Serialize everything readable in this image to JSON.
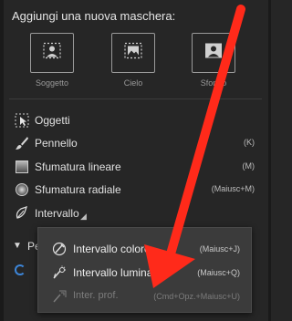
{
  "panel": {
    "heading": "Aggiungi una nuova maschera:",
    "mask_buttons": [
      {
        "label": "Soggetto",
        "icon": "subject-icon"
      },
      {
        "label": "Cielo",
        "icon": "sky-icon"
      },
      {
        "label": "Sfondo",
        "icon": "background-icon"
      }
    ]
  },
  "tools": [
    {
      "label": "Oggetti",
      "shortcut": "",
      "icon": "objects-icon"
    },
    {
      "label": "Pennello",
      "shortcut": "(K)",
      "icon": "brush-icon"
    },
    {
      "label": "Sfumatura lineare",
      "shortcut": "(M)",
      "icon": "linear-gradient-icon"
    },
    {
      "label": "Sfumatura radiale",
      "shortcut": "(Maiusc+M)",
      "icon": "radial-gradient-icon"
    },
    {
      "label": "Intervallo",
      "shortcut": "",
      "icon": "range-icon"
    }
  ],
  "section": {
    "label": "Pe",
    "collapsed_indicator": "▼"
  },
  "flyout": {
    "items": [
      {
        "label": "Intervallo colore",
        "shortcut": "(Maiusc+J)",
        "enabled": true,
        "icon": "color-range-icon"
      },
      {
        "label": "Intervallo luminanza",
        "shortcut": "(Maiusc+Q)",
        "enabled": true,
        "icon": "luminance-range-icon"
      },
      {
        "label": "Inter. prof.",
        "shortcut": "(Cmd+Opz.+Maiusc+U)",
        "enabled": false,
        "icon": "depth-range-icon"
      }
    ]
  },
  "colors": {
    "panel_bg": "#262626",
    "flyout_bg": "#3b3b3b",
    "annotation_arrow": "#ff2a1a",
    "spinner": "#3d86d9"
  }
}
